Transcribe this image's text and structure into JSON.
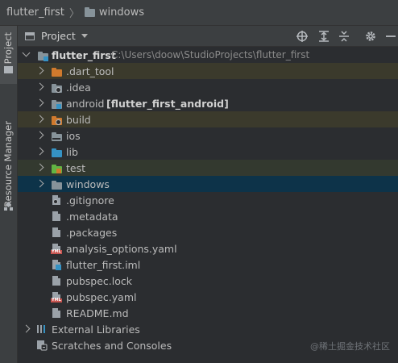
{
  "breadcrumb": {
    "project": "flutter_first",
    "folder": "windows"
  },
  "sidebar": {
    "project_tab": "Project",
    "resource_tab": "Resource Manager"
  },
  "toolbar": {
    "view_label": "Project"
  },
  "tree": {
    "root": {
      "name": "flutter_first",
      "path": "C:\\Users\\doow\\StudioProjects\\flutter_first"
    },
    "folders": [
      {
        "name": ".dart_tool"
      },
      {
        "name": ".idea"
      },
      {
        "name": "android",
        "suffix": "[flutter_first_android]"
      },
      {
        "name": "build"
      },
      {
        "name": "ios"
      },
      {
        "name": "lib"
      },
      {
        "name": "test"
      },
      {
        "name": "windows"
      }
    ],
    "files": [
      {
        "name": ".gitignore"
      },
      {
        "name": ".metadata"
      },
      {
        "name": ".packages"
      },
      {
        "name": "analysis_options.yaml"
      },
      {
        "name": "flutter_first.iml"
      },
      {
        "name": "pubspec.lock"
      },
      {
        "name": "pubspec.yaml"
      },
      {
        "name": "README.md"
      }
    ],
    "external_libraries": "External Libraries",
    "scratches": "Scratches and Consoles"
  },
  "colors": {
    "selection": "#0d3349",
    "excluded": "#3b3a2c",
    "test": "#33392f",
    "folder": "#87939a",
    "module": "#3592c4",
    "excluded_folder": "#d07a2d"
  },
  "watermark": "@稀土掘金技术社区"
}
